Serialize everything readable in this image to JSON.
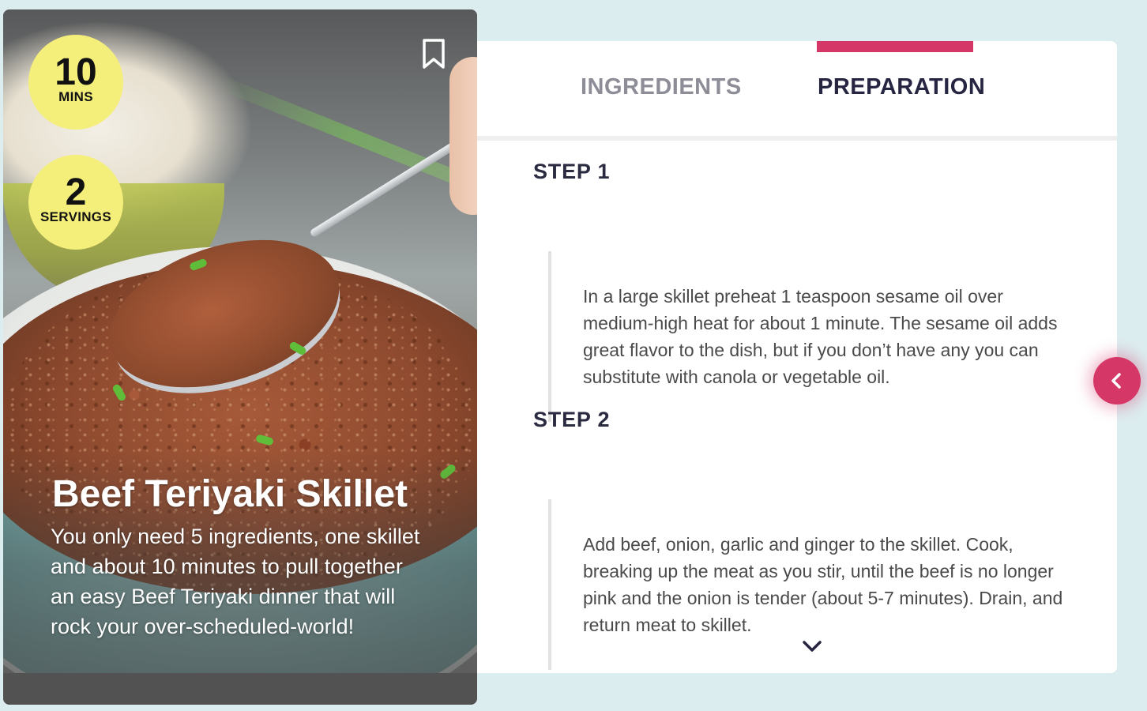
{
  "recipe": {
    "title": "Beef Teriyaki Skillet",
    "description": "You only need 5 ingredients, one skillet and about 10 minutes to pull together an easy Beef Teriyaki dinner that will rock your over-scheduled-world!",
    "time": {
      "value": "10",
      "unit": "MINS"
    },
    "servings": {
      "value": "2",
      "unit": "SERVINGS"
    }
  },
  "tabs": [
    {
      "label": "INGREDIENTS",
      "active": false
    },
    {
      "label": "PREPARATION",
      "active": true
    }
  ],
  "steps": [
    {
      "title": "STEP 1",
      "text": "In a large skillet preheat 1 teaspoon sesame oil over medium-high heat for about 1 minute. The sesame oil adds great flavor to the dish, but if you don’t have any you can substitute with canola or vegetable oil."
    },
    {
      "title": "STEP 2",
      "text": "Add beef, onion, garlic and ginger to the skillet. Cook, breaking up the meat as you stir, until the beef is no longer pink and the onion is tender (about 5-7 minutes). Drain, and return meat to skillet."
    }
  ],
  "icons": {
    "bookmark": "bookmark-icon",
    "scroll_down": "chevron-down-icon",
    "collapse": "chevron-left-icon"
  },
  "colors": {
    "accent": "#d53767",
    "badge": "#f4ee7a",
    "background": "#dcedf0",
    "active_tab": "#262542",
    "inactive_tab": "#8d8d98"
  }
}
